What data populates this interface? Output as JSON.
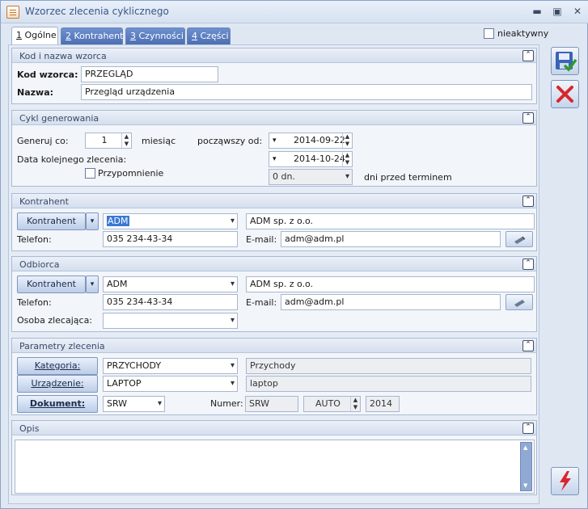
{
  "window": {
    "title": "Wzorzec zlecenia cyklicznego",
    "inactive_label": "nieaktywny"
  },
  "tabs": [
    {
      "key": "1",
      "label": " Ogólne"
    },
    {
      "key": "2",
      "label": " Kontrahent"
    },
    {
      "key": "3",
      "label": " Czynności"
    },
    {
      "key": "4",
      "label": " Części"
    }
  ],
  "kod": {
    "section_title": "Kod i nazwa wzorca",
    "kod_label": "Kod wzorca:",
    "kod_value": "PRZEGLĄD",
    "nazwa_label": "Nazwa:",
    "nazwa_value": "Przegląd urządzenia"
  },
  "cykl": {
    "section_title": "Cykl generowania",
    "generuj_label": "Generuj co:",
    "generuj_value": "1",
    "unit": "miesiąc",
    "od_label": "począwszy od:",
    "od_value": "2014-09-22",
    "next_label": "Data kolejnego zlecenia:",
    "next_value": "2014-10-24",
    "reminder_label": "Przypomnienie",
    "days_value": "0 dn.",
    "days_suffix": "dni przed terminem"
  },
  "kontrahent": {
    "section_title": "Kontrahent",
    "btn_label": "Kontrahent",
    "code": "ADM",
    "name": "ADM sp. z o.o.",
    "tel_label": "Telefon:",
    "tel_value": "035 234-43-34",
    "email_label": "E-mail:",
    "email_value": "adm@adm.pl"
  },
  "odbiorca": {
    "section_title": "Odbiorca",
    "btn_label": "Kontrahent",
    "code": "ADM",
    "name": "ADM sp. z o.o.",
    "tel_label": "Telefon:",
    "tel_value": "035 234-43-34",
    "email_label": "E-mail:",
    "email_value": "adm@adm.pl",
    "osoba_label": "Osoba zlecająca:",
    "osoba_value": ""
  },
  "parametry": {
    "section_title": "Parametry zlecenia",
    "kat_btn": "Kategoria:",
    "kat_value": "PRZYCHODY",
    "kat_desc": "Przychody",
    "urz_btn": "Urządzenie:",
    "urz_value": "LAPTOP",
    "urz_desc": "laptop",
    "dok_btn": "Dokument:",
    "dok_value": "SRW",
    "numer_label": "Numer:",
    "numer_1": "SRW",
    "numer_2": "AUTO",
    "numer_3": "2014"
  },
  "opis": {
    "section_title": "Opis",
    "text": ""
  },
  "icons": {
    "save": "save-disk-icon",
    "cancel": "cancel-x-icon",
    "lightning": "lightning-icon"
  }
}
